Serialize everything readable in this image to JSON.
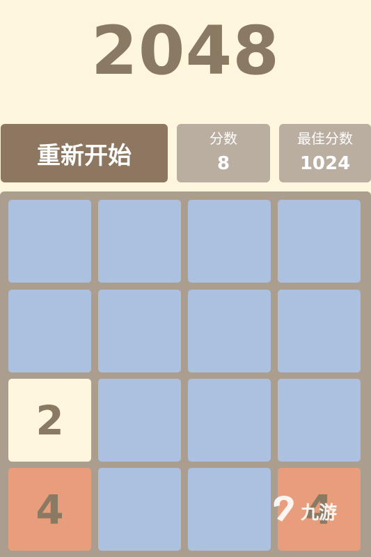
{
  "header": {
    "title": "2048"
  },
  "controls": {
    "restart_label": "重新开始"
  },
  "scores": {
    "score_label": "分数",
    "score_value": "8",
    "best_label": "最佳分数",
    "best_value": "1024"
  },
  "board": {
    "rows": [
      [
        "",
        "",
        "",
        ""
      ],
      [
        "",
        "",
        "",
        ""
      ],
      [
        "2",
        "",
        "",
        ""
      ],
      [
        "4",
        "",
        "",
        "4"
      ]
    ]
  },
  "watermark": {
    "text": "九游",
    "icon": "nine-game-logo-icon"
  },
  "colors": {
    "background": "#fef7dd",
    "title": "#8b7a63",
    "restart_button": "#8d7760",
    "score_box": "#baaea0",
    "board": "#ab9e8f",
    "empty_tile": "#acc1df",
    "tile_2": "#fef7dd",
    "tile_4": "#e89e7d"
  }
}
